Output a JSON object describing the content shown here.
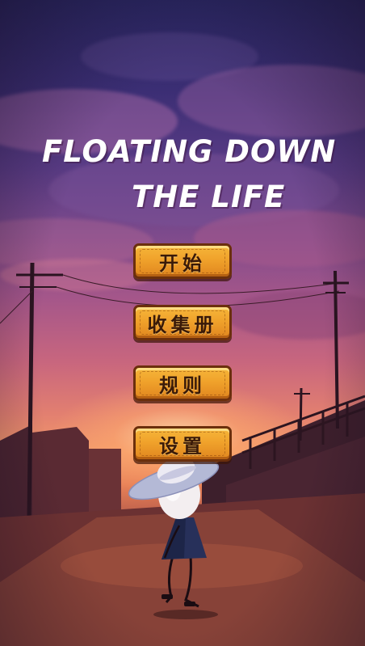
{
  "game": {
    "title_line1": "FLOATING DOWN",
    "title_line2": "THE LIFE"
  },
  "menu": {
    "start_label": "开始",
    "collection_label": "收集册",
    "rules_label": "规则",
    "settings_label": "设置"
  },
  "colors": {
    "button_fill": "#f0a22b",
    "button_border": "#6b2f0c",
    "title_text": "#ffffff"
  }
}
